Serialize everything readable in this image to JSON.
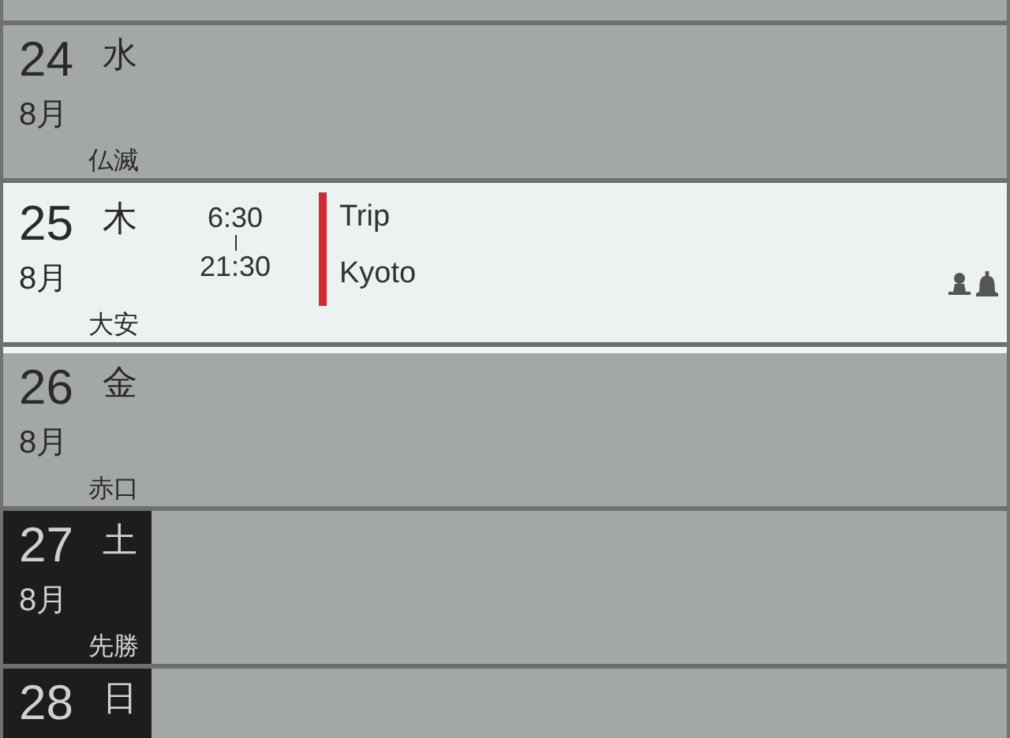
{
  "days": [
    {
      "selected": false,
      "weekend": false,
      "partial": true
    },
    {
      "day": "24",
      "weekday": "水",
      "month": "8月",
      "rokuyo": "仏滅",
      "selected": false,
      "weekend": false,
      "partial": false
    },
    {
      "day": "25",
      "weekday": "木",
      "month": "8月",
      "rokuyo": "大安",
      "selected": true,
      "weekend": false,
      "partial": false,
      "events": [
        {
          "start": "6:30",
          "end": "21:30",
          "title": "Trip",
          "location": "Kyoto",
          "color": "#d42a2f",
          "has_attendees": true,
          "has_alarm": true
        }
      ]
    },
    {
      "day": "26",
      "weekday": "金",
      "month": "8月",
      "rokuyo": "赤口",
      "selected": false,
      "weekend": false,
      "partial": false
    },
    {
      "day": "27",
      "weekday": "土",
      "month": "8月",
      "rokuyo": "先勝",
      "selected": false,
      "weekend": true,
      "partial": false
    },
    {
      "day": "28",
      "weekday": "日",
      "selected": false,
      "weekend": true,
      "partial": false
    }
  ]
}
